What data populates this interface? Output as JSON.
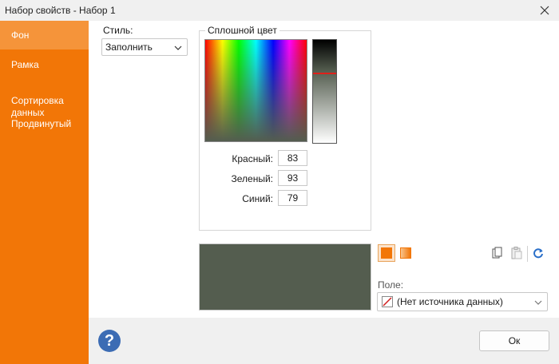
{
  "window": {
    "title": "Набор свойств - Набор 1",
    "close_icon": "close-icon"
  },
  "sidebar": {
    "items": [
      {
        "label": "Фон",
        "active": true
      },
      {
        "label": "Рамка",
        "active": false
      },
      {
        "label": "Сортировка\nданных",
        "active": false
      },
      {
        "label": "Продвинутый",
        "active": false
      }
    ]
  },
  "style": {
    "label": "Стиль:",
    "value": "Заполнить"
  },
  "solid_color": {
    "title": "Сплошной цвет",
    "red_label": "Красный:",
    "red": "83",
    "green_label": "Зеленый:",
    "green": "93",
    "blue_label": "Синий:",
    "blue": "79",
    "preview_color": "#545d4f"
  },
  "fill_modes": {
    "solid_icon": "solid-fill-icon",
    "gradient_icon": "gradient-fill-icon",
    "accent": "#f27607"
  },
  "toolbar": {
    "copy_icon": "copy-icon",
    "paste_icon": "paste-icon",
    "refresh_icon": "refresh-icon"
  },
  "field": {
    "label": "Поле:",
    "value": "(Нет источника данных)"
  },
  "footer": {
    "ok_label": "Ок",
    "help_icon": "help-icon"
  },
  "colors": {
    "sidebar": "#f27607",
    "sidebar_active": "#f5943a"
  }
}
